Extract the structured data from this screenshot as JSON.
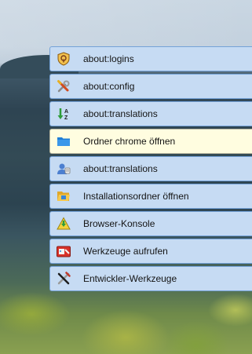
{
  "menu": {
    "items": [
      {
        "label": "about:logins",
        "icon": "logins-shield-icon",
        "active": false
      },
      {
        "label": "about:config",
        "icon": "tools-icon",
        "active": false
      },
      {
        "label": "about:translations",
        "icon": "sort-az-icon",
        "active": false
      },
      {
        "label": "Ordner chrome öffnen",
        "icon": "folder-icon",
        "active": true
      },
      {
        "label": "about:translations",
        "icon": "user-icon",
        "active": false
      },
      {
        "label": "Installationsordner öffnen",
        "icon": "folder-open-icon",
        "active": false
      },
      {
        "label": "Browser-Konsole",
        "icon": "console-icon",
        "active": false
      },
      {
        "label": "Werkzeuge aufrufen",
        "icon": "toolbox-icon",
        "active": false
      },
      {
        "label": "Entwickler-Werkzeuge",
        "icon": "dev-tools-icon",
        "active": false
      }
    ]
  },
  "colors": {
    "item_bg": "#c6dbf3",
    "item_border": "#74a2d8",
    "active_bg": "#fffde0"
  }
}
